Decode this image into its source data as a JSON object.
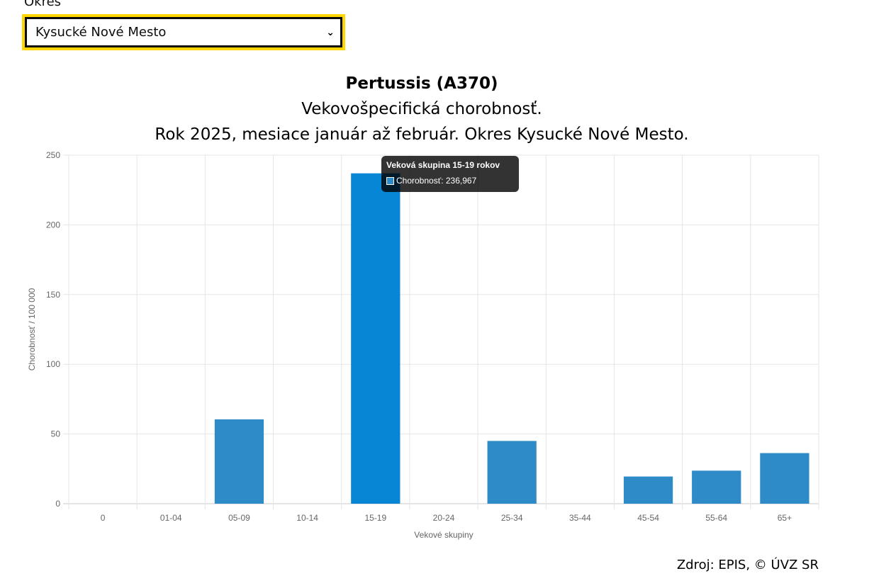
{
  "filter": {
    "label": "Okres",
    "selected": "Kysucké Nové Mesto"
  },
  "chart_data": {
    "type": "bar",
    "title": "Pertussis (A370)",
    "subtitle": "Vekovošpecifická chorobnosť.",
    "subtitle2": "Rok 2025, mesiace január až február. Okres Kysucké Nové Mesto.",
    "xlabel": "Vekové skupiny",
    "ylabel": "Chorobnosť / 100 000",
    "categories": [
      "0",
      "01-04",
      "05-09",
      "10-14",
      "15-19",
      "20-24",
      "25-34",
      "35-44",
      "45-54",
      "55-64",
      "65+"
    ],
    "values": [
      0,
      0,
      60.5,
      0,
      236.967,
      0,
      45,
      0,
      19.5,
      23.7,
      36.3
    ],
    "ylim": [
      0,
      250
    ],
    "yticks": [
      0,
      50,
      100,
      150,
      200,
      250
    ],
    "grid": true,
    "highlight_index": 4,
    "colors": {
      "bar": "#2e8bc8",
      "bar_hover": "#0686d4",
      "grid": "#e5e5e5"
    }
  },
  "tooltip": {
    "title": "Veková skupina 15-19 rokov",
    "label": "Chorobnosť: 236,967"
  },
  "source": "Zdroj: EPIS, © ÚVZ SR"
}
